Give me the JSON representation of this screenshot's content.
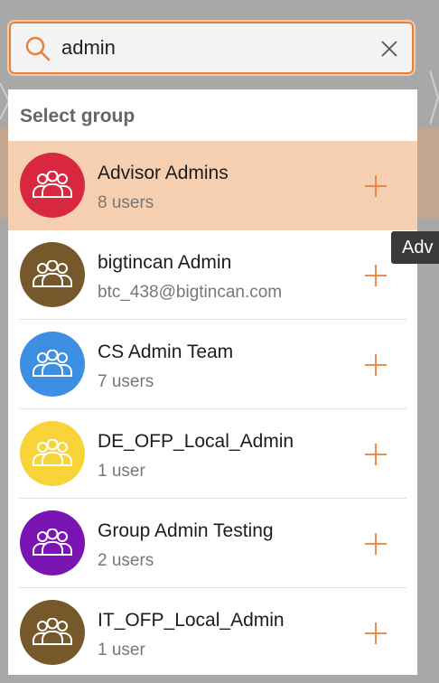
{
  "search": {
    "value": "admin",
    "placeholder": ""
  },
  "panel": {
    "title": "Select group"
  },
  "groups": [
    {
      "name": "Advisor Admins",
      "sub": "8 users",
      "color": "#d8283f",
      "active": true
    },
    {
      "name": "bigtincan Admin",
      "sub": "btc_438@bigtincan.com",
      "color": "#76582b",
      "active": false
    },
    {
      "name": "CS Admin Team",
      "sub": "7 users",
      "color": "#3d8fe3",
      "active": false
    },
    {
      "name": "DE_OFP_Local_Admin",
      "sub": "1 user",
      "color": "#f8d43a",
      "active": false
    },
    {
      "name": "Group Admin Testing",
      "sub": "2 users",
      "color": "#7a14b3",
      "active": false
    },
    {
      "name": "IT_OFP_Local_Admin",
      "sub": "1 user",
      "color": "#76582b",
      "active": false
    }
  ],
  "tooltip": {
    "text": "Adv"
  },
  "colors": {
    "accent": "#e8803c",
    "active_row": "#f6cfb1"
  },
  "icons": {
    "search": "search-icon",
    "clear": "close-icon",
    "group": "group-icon",
    "add": "plus-icon"
  }
}
